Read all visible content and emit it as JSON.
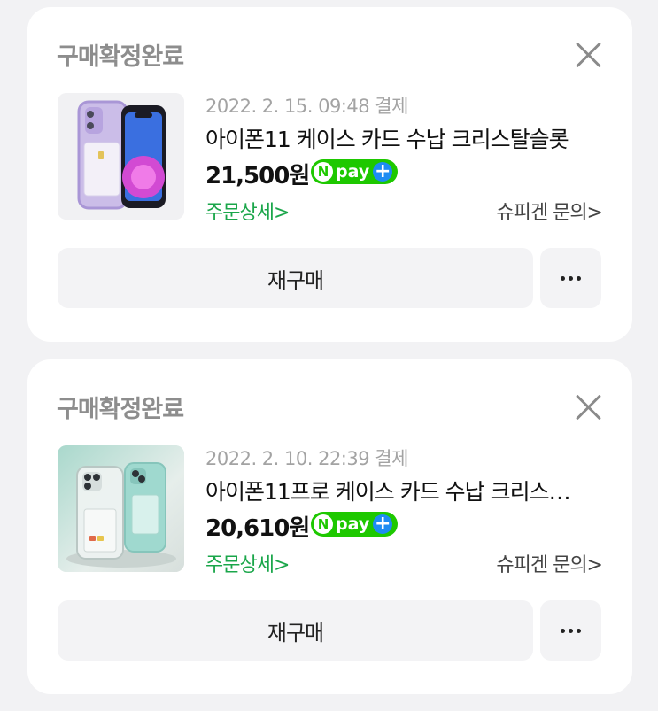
{
  "orders": [
    {
      "status": "구매확정완료",
      "date": "2022. 2. 15. 09:48 결제",
      "product_name": "아이폰11 케이스 카드 수납 크리스탈슬롯",
      "price": "21,500원",
      "npay": {
        "n": "N",
        "pay": "pay",
        "plus": "+"
      },
      "detail_link": "주문상세>",
      "inquiry_link": "슈피겐 문의>",
      "rebuy_label": "재구매",
      "thumb_icon": "phone-case-purple-icon"
    },
    {
      "status": "구매확정완료",
      "date": "2022. 2. 10. 22:39 결제",
      "product_name": "아이폰11프로 케이스 카드 수납 크리스…",
      "price": "20,610원",
      "npay": {
        "n": "N",
        "pay": "pay",
        "plus": "+"
      },
      "detail_link": "주문상세>",
      "inquiry_link": "슈피겐 문의>",
      "rebuy_label": "재구매",
      "thumb_icon": "phone-case-clear-icon"
    }
  ],
  "colors": {
    "background": "#f2f2f4",
    "card": "#ffffff",
    "status_text": "#8d8d8d",
    "link_green": "#1aa64a",
    "npay_green": "#1ec800",
    "npay_blue": "#1d8cf2",
    "button_bg": "#f3f3f5"
  }
}
